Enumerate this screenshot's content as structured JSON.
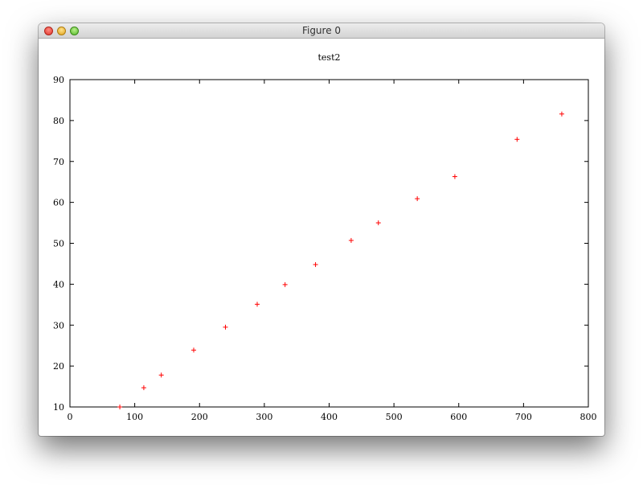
{
  "window": {
    "title": "Figure 0"
  },
  "colors": {
    "marker": "#ff0000",
    "axis": "#000000"
  },
  "chart_data": {
    "type": "scatter",
    "title": "test2",
    "xlabel": "",
    "ylabel": "",
    "xlim": [
      0,
      800
    ],
    "ylim": [
      10,
      90
    ],
    "xticks": [
      0,
      100,
      200,
      300,
      400,
      500,
      600,
      700,
      800
    ],
    "yticks": [
      10,
      20,
      30,
      40,
      50,
      60,
      70,
      80,
      90
    ],
    "grid": false,
    "marker": "+",
    "series": [
      {
        "x": [
          77,
          114,
          141,
          191,
          240,
          289,
          332,
          379,
          434,
          476,
          536,
          594,
          690,
          759
        ],
        "y": [
          10.0,
          14.7,
          17.8,
          23.9,
          29.5,
          35.1,
          39.9,
          44.8,
          50.7,
          55.0,
          60.9,
          66.3,
          75.4,
          81.6
        ]
      }
    ]
  }
}
